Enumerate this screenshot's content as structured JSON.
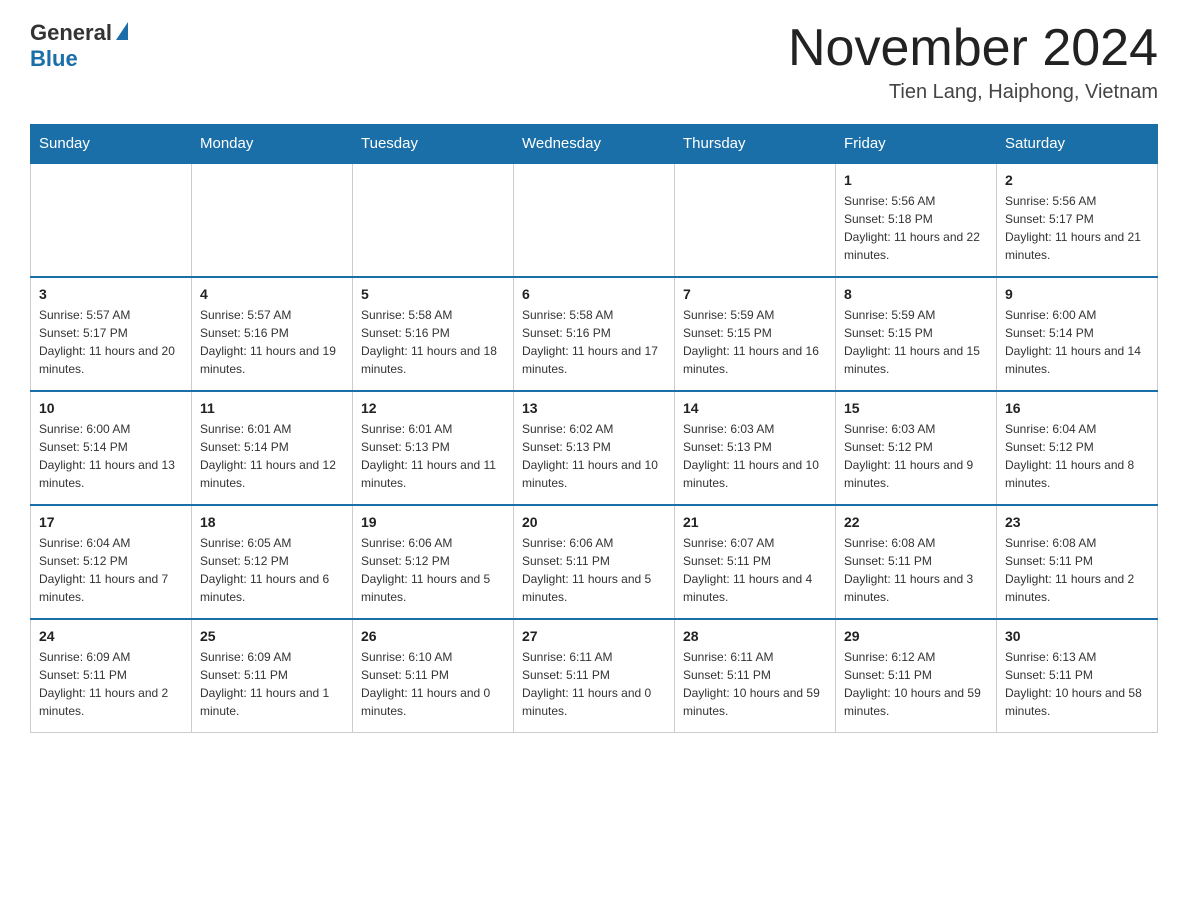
{
  "logo": {
    "name_part1": "General",
    "name_part2": "Blue"
  },
  "title": "November 2024",
  "subtitle": "Tien Lang, Haiphong, Vietnam",
  "weekdays": [
    "Sunday",
    "Monday",
    "Tuesday",
    "Wednesday",
    "Thursday",
    "Friday",
    "Saturday"
  ],
  "weeks": [
    [
      {
        "day": "",
        "empty": true
      },
      {
        "day": "",
        "empty": true
      },
      {
        "day": "",
        "empty": true
      },
      {
        "day": "",
        "empty": true
      },
      {
        "day": "",
        "empty": true
      },
      {
        "day": "1",
        "sunrise": "5:56 AM",
        "sunset": "5:18 PM",
        "daylight": "11 hours and 22 minutes."
      },
      {
        "day": "2",
        "sunrise": "5:56 AM",
        "sunset": "5:17 PM",
        "daylight": "11 hours and 21 minutes."
      }
    ],
    [
      {
        "day": "3",
        "sunrise": "5:57 AM",
        "sunset": "5:17 PM",
        "daylight": "11 hours and 20 minutes."
      },
      {
        "day": "4",
        "sunrise": "5:57 AM",
        "sunset": "5:16 PM",
        "daylight": "11 hours and 19 minutes."
      },
      {
        "day": "5",
        "sunrise": "5:58 AM",
        "sunset": "5:16 PM",
        "daylight": "11 hours and 18 minutes."
      },
      {
        "day": "6",
        "sunrise": "5:58 AM",
        "sunset": "5:16 PM",
        "daylight": "11 hours and 17 minutes."
      },
      {
        "day": "7",
        "sunrise": "5:59 AM",
        "sunset": "5:15 PM",
        "daylight": "11 hours and 16 minutes."
      },
      {
        "day": "8",
        "sunrise": "5:59 AM",
        "sunset": "5:15 PM",
        "daylight": "11 hours and 15 minutes."
      },
      {
        "day": "9",
        "sunrise": "6:00 AM",
        "sunset": "5:14 PM",
        "daylight": "11 hours and 14 minutes."
      }
    ],
    [
      {
        "day": "10",
        "sunrise": "6:00 AM",
        "sunset": "5:14 PM",
        "daylight": "11 hours and 13 minutes."
      },
      {
        "day": "11",
        "sunrise": "6:01 AM",
        "sunset": "5:14 PM",
        "daylight": "11 hours and 12 minutes."
      },
      {
        "day": "12",
        "sunrise": "6:01 AM",
        "sunset": "5:13 PM",
        "daylight": "11 hours and 11 minutes."
      },
      {
        "day": "13",
        "sunrise": "6:02 AM",
        "sunset": "5:13 PM",
        "daylight": "11 hours and 10 minutes."
      },
      {
        "day": "14",
        "sunrise": "6:03 AM",
        "sunset": "5:13 PM",
        "daylight": "11 hours and 10 minutes."
      },
      {
        "day": "15",
        "sunrise": "6:03 AM",
        "sunset": "5:12 PM",
        "daylight": "11 hours and 9 minutes."
      },
      {
        "day": "16",
        "sunrise": "6:04 AM",
        "sunset": "5:12 PM",
        "daylight": "11 hours and 8 minutes."
      }
    ],
    [
      {
        "day": "17",
        "sunrise": "6:04 AM",
        "sunset": "5:12 PM",
        "daylight": "11 hours and 7 minutes."
      },
      {
        "day": "18",
        "sunrise": "6:05 AM",
        "sunset": "5:12 PM",
        "daylight": "11 hours and 6 minutes."
      },
      {
        "day": "19",
        "sunrise": "6:06 AM",
        "sunset": "5:12 PM",
        "daylight": "11 hours and 5 minutes."
      },
      {
        "day": "20",
        "sunrise": "6:06 AM",
        "sunset": "5:11 PM",
        "daylight": "11 hours and 5 minutes."
      },
      {
        "day": "21",
        "sunrise": "6:07 AM",
        "sunset": "5:11 PM",
        "daylight": "11 hours and 4 minutes."
      },
      {
        "day": "22",
        "sunrise": "6:08 AM",
        "sunset": "5:11 PM",
        "daylight": "11 hours and 3 minutes."
      },
      {
        "day": "23",
        "sunrise": "6:08 AM",
        "sunset": "5:11 PM",
        "daylight": "11 hours and 2 minutes."
      }
    ],
    [
      {
        "day": "24",
        "sunrise": "6:09 AM",
        "sunset": "5:11 PM",
        "daylight": "11 hours and 2 minutes."
      },
      {
        "day": "25",
        "sunrise": "6:09 AM",
        "sunset": "5:11 PM",
        "daylight": "11 hours and 1 minute."
      },
      {
        "day": "26",
        "sunrise": "6:10 AM",
        "sunset": "5:11 PM",
        "daylight": "11 hours and 0 minutes."
      },
      {
        "day": "27",
        "sunrise": "6:11 AM",
        "sunset": "5:11 PM",
        "daylight": "11 hours and 0 minutes."
      },
      {
        "day": "28",
        "sunrise": "6:11 AM",
        "sunset": "5:11 PM",
        "daylight": "10 hours and 59 minutes."
      },
      {
        "day": "29",
        "sunrise": "6:12 AM",
        "sunset": "5:11 PM",
        "daylight": "10 hours and 59 minutes."
      },
      {
        "day": "30",
        "sunrise": "6:13 AM",
        "sunset": "5:11 PM",
        "daylight": "10 hours and 58 minutes."
      }
    ]
  ]
}
